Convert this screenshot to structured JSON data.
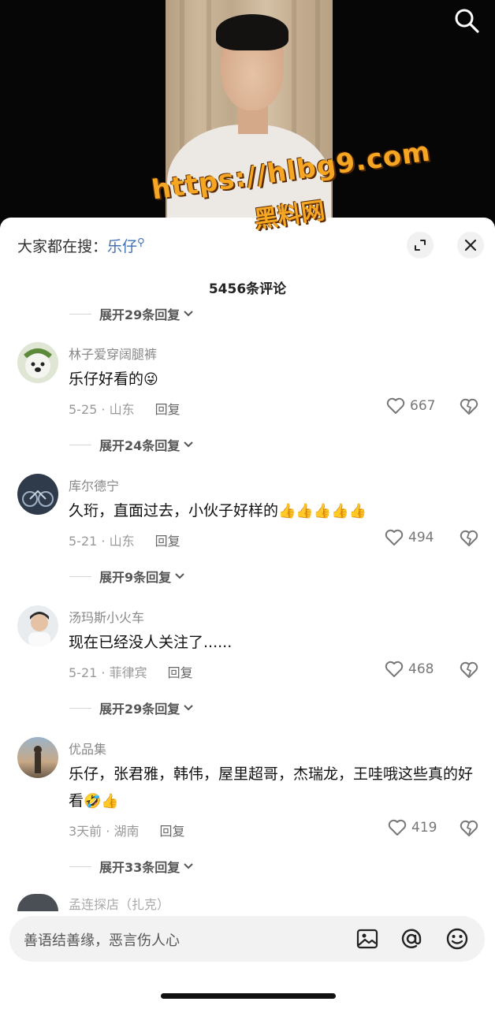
{
  "video": {
    "caption": "",
    "watermark": {
      "url": "https://hlbg9.com",
      "name": "黑料网"
    }
  },
  "sheet": {
    "search_prefix": "大家都在搜：",
    "search_hot": "乐仔",
    "comment_count": "5456条评论"
  },
  "expand_rows": [
    {
      "label": "展开29条回复"
    },
    {
      "label": "展开24条回复"
    },
    {
      "label": "展开9条回复"
    },
    {
      "label": "展开29条回复"
    },
    {
      "label": "展开33条回复"
    }
  ],
  "comments": [
    {
      "username": "林子爱穿阔腿裤",
      "text": "乐仔好看的",
      "emoji": "😜",
      "date_location": "5-25 · 山东",
      "reply": "回复",
      "likes": "667"
    },
    {
      "username": "库尔德宁",
      "text": "久珩，直面过去，小伙子好样的",
      "emoji": "👍👍👍👍👍",
      "date_location": "5-21 · 山东",
      "reply": "回复",
      "likes": "494"
    },
    {
      "username": "汤玛斯小火车",
      "text": "现在已经没人关注了......",
      "emoji": "",
      "date_location": "5-21 · 菲律宾",
      "reply": "回复",
      "likes": "468"
    },
    {
      "username": "优品集",
      "text": "乐仔，张君雅，韩伟，屋里超哥，杰瑞龙，王哇哦这些真的好看",
      "emoji": "🤣👍",
      "date_location": "3天前 · 湖南",
      "reply": "回复",
      "likes": "419"
    }
  ],
  "partial_username": "孟连探店（扎克）",
  "input": {
    "placeholder": "善语结善缘，恶言伤人心"
  },
  "icons": {
    "search": "search-icon",
    "expand": "expand-icon",
    "close": "close-icon",
    "heart": "heart-icon",
    "broken_heart": "broken-heart-icon",
    "image": "image-icon",
    "mention": "at-icon",
    "emoji": "smile-icon"
  },
  "colors": {
    "accent_blue": "#3e6fb5",
    "watermark_orange": "#f5a623"
  }
}
